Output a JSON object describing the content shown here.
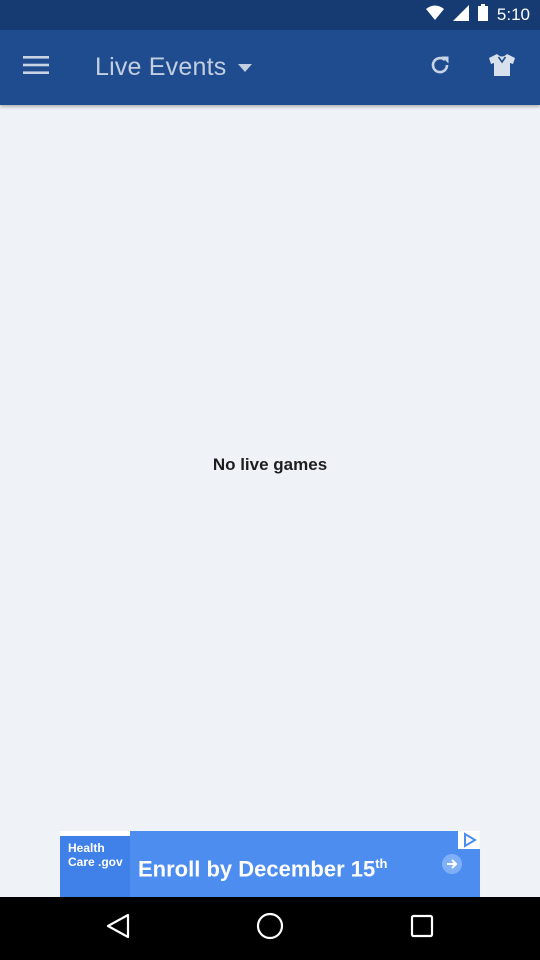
{
  "status_bar": {
    "time": "5:10"
  },
  "app_bar": {
    "title": "Live Events",
    "menu_icon": "hamburger-menu-icon",
    "dropdown_icon": "caret-down-icon",
    "refresh_icon": "refresh-icon",
    "shirt_icon": "jersey-icon"
  },
  "main": {
    "empty_message": "No live games"
  },
  "ad": {
    "logo_text": "Health Care .gov",
    "headline": "Enroll by December 15",
    "headline_suffix": "th"
  },
  "colors": {
    "status_bar": "#163a72",
    "app_bar": "#1f4c8f",
    "background": "#eff3f7",
    "ad_background": "#4d8df0"
  }
}
